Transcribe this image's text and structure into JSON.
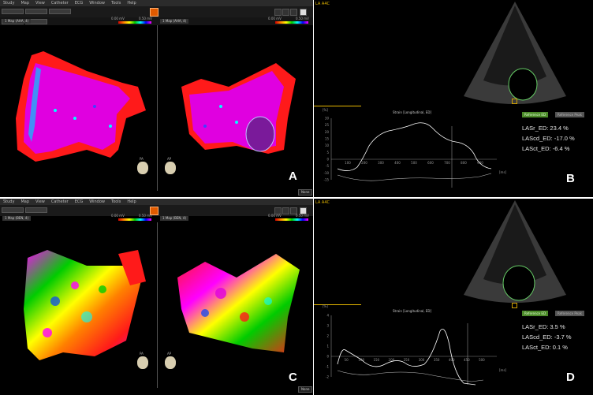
{
  "menu": [
    "Study",
    "Map",
    "View",
    "Catheter",
    "ECG",
    "Window",
    "Tools",
    "Help"
  ],
  "panels": {
    "A": {
      "letter": "A",
      "map_left_tag": "1 Map (AHA, 4)",
      "map_right_tag": "1 Map (AHA, 4)",
      "scale_min": "0.00 mV",
      "scale_max": "0.50 mV",
      "view_labels": [
        "PA",
        "AP"
      ],
      "none_label": "None"
    },
    "B": {
      "letter": "B",
      "title": "LA A4C",
      "strain_title": "Strain [Longitudinal, ED]",
      "y_unit": "[%]",
      "x_unit": "[ms]",
      "y_ticks": [
        "30",
        "25",
        "20",
        "15",
        "10",
        "5",
        "0",
        "-5",
        "-10",
        "-15"
      ],
      "x_ticks": [
        "100",
        "200",
        "300",
        "400",
        "500",
        "600",
        "700",
        "800",
        "900"
      ],
      "ref_ed": "Reference ED",
      "ref_peak": "Reference Peak",
      "metrics": [
        "LASr_ED: 23.4 %",
        "LAScd_ED: -17.0 %",
        "LASct_ED: -6.4 %"
      ]
    },
    "C": {
      "letter": "C",
      "map_left_tag": "1 Map (BEN, 4)",
      "map_right_tag": "1 Map (BEN, 4)",
      "scale_min": "0.00 mV",
      "scale_max": "0.50 mV",
      "view_labels": [
        "PA",
        "AP"
      ],
      "none_label": "None"
    },
    "D": {
      "letter": "D",
      "title": "LA A4C",
      "strain_title": "Strain [Longitudinal, ED]",
      "y_unit": "[%]",
      "x_unit": "[ms]",
      "y_ticks": [
        "4",
        "3",
        "2",
        "1",
        "0",
        "-1",
        "-2"
      ],
      "x_ticks": [
        "50",
        "100",
        "150",
        "200",
        "250",
        "300",
        "350",
        "400",
        "450",
        "500"
      ],
      "ref_ed": "Reference ED",
      "ref_peak": "Reference Peak",
      "metrics": [
        "LASr_ED: 3.5 %",
        "LAScd_ED: -3.7 %",
        "LASct_ED: 0.1 %"
      ]
    }
  },
  "colors": {
    "voltage_healthy": "#e000e0",
    "voltage_scar": "#ff1a1a",
    "strain_curve": "#ffffff",
    "title_accent": "#e6b800",
    "contour": "#66cc66"
  }
}
